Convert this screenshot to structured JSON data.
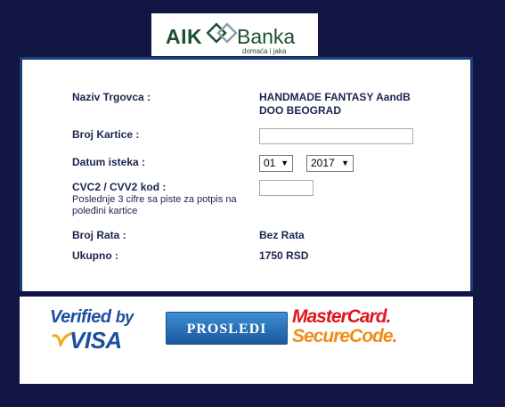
{
  "logo": {
    "brand_left": "AIK",
    "brand_right": "Banka",
    "tagline": "domaća i jaka",
    "color": "#1c4f2e"
  },
  "form": {
    "merchant_label": "Naziv Trgovca :",
    "merchant_value": "HANDMADE FANTASY AandB DOO BEOGRAD",
    "card_label": "Broj Kartice :",
    "card_value": "",
    "expiry_label": "Datum isteka :",
    "expiry_month": "01",
    "expiry_year": "2017",
    "cvc_label": "CVC2 / CVV2 kod :",
    "cvc_hint": "Poslednje 3 cifre sa piste za potpis na poleđini kartice",
    "cvc_value": "",
    "installments_label": "Broj Rata :",
    "installments_value": "Bez Rata",
    "total_label": "Ukupno :",
    "total_value": "1750 RSD"
  },
  "footer": {
    "verified_line1": "Verified",
    "verified_by": "by",
    "verified_line2": "VISA",
    "submit_label": "PROSLEDI",
    "mastercard_line1": "MasterCard.",
    "mastercard_line2": "SecureCode."
  },
  "colors": {
    "page_background": "#131545",
    "panel_border": "#1b3f7a",
    "label_text": "#1b2450",
    "button": "#2a73b8",
    "visa_blue": "#1a4fa0",
    "mastercard_red": "#e0161f",
    "mastercard_orange": "#f08c1a"
  },
  "icons": {
    "select_arrow": "triangle-down-icon",
    "logo_mark": "interlinked-squares-icon"
  }
}
